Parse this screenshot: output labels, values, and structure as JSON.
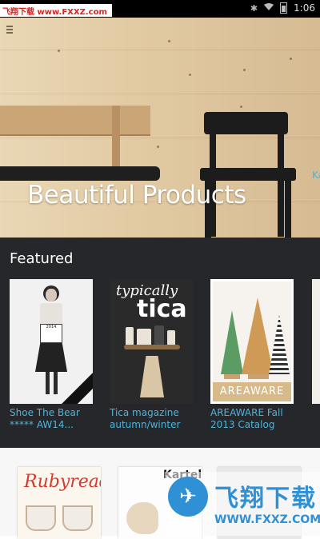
{
  "status_bar": {
    "watermark": "飞翔下载 www.FXXZ.com",
    "time": "1:06",
    "icons": [
      "bluetooth-icon",
      "wifi-icon",
      "battery-icon"
    ]
  },
  "hero": {
    "title": "Beautiful Products",
    "menu_icon": "menu-icon"
  },
  "featured": {
    "title": "Featured",
    "items": [
      {
        "title": "Shoe The Bear\n***** AW14...",
        "cover_text": "2014"
      },
      {
        "title": "Tica magazine\nautumn/winter",
        "cover_mast_1": "typically",
        "cover_mast_2": "tica"
      },
      {
        "title": "AREAWARE Fall\n2013 Catalog",
        "cover_brand": "AREAWARE"
      },
      {
        "title": "Ka"
      }
    ]
  },
  "bottom": {
    "books": [
      {
        "logo": "Rubyread"
      },
      {
        "logo": "Kartell"
      },
      {
        "logo": ""
      }
    ]
  },
  "watermark_bottom": {
    "brand": "飞翔下载",
    "url": "WWW.FXXZ.COM"
  },
  "colors": {
    "featured_bg": "#26272b",
    "link_blue": "#4fb4d8",
    "status_bar_bg": "#000000"
  }
}
